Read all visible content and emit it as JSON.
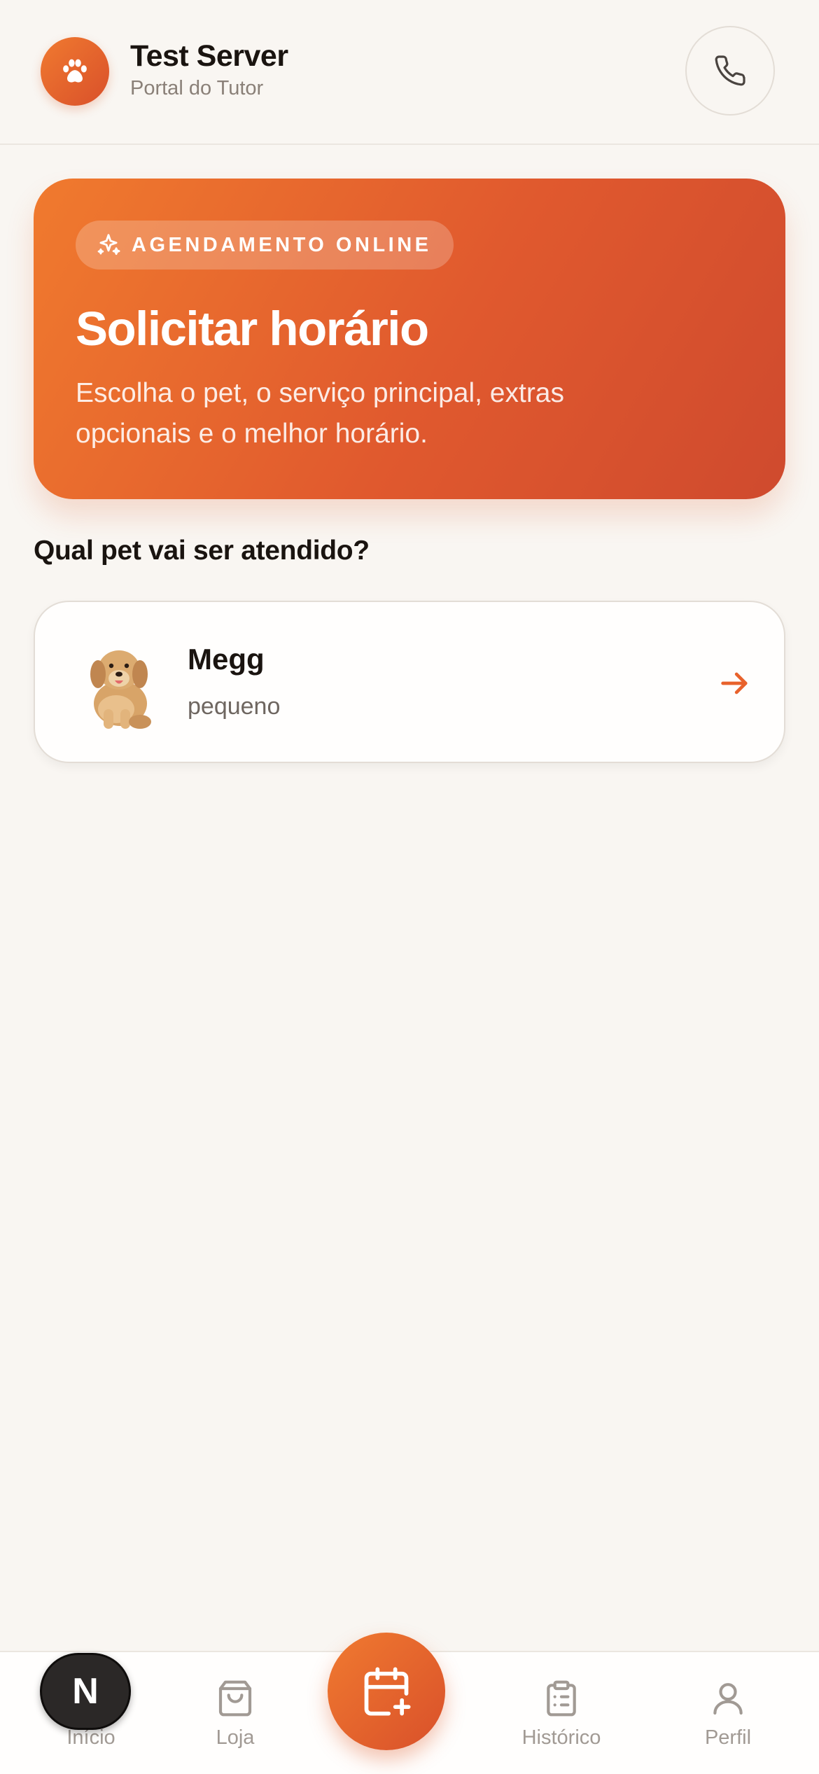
{
  "header": {
    "app_title": "Test Server",
    "subtitle": "Portal do Tutor",
    "logo_icon": "paw-icon",
    "action_icon": "phone-icon"
  },
  "hero": {
    "badge": "AGENDAMENTO ONLINE",
    "badge_icon": "sparkles-icon",
    "title": "Solicitar horário",
    "description": "Escolha o pet, o serviço principal, extras opcionais e o melhor horário."
  },
  "section": {
    "title": "Qual pet vai ser atendido?"
  },
  "pets": [
    {
      "name": "Megg",
      "size": "pequeno",
      "photo": "golden-retriever-puppy",
      "action_icon": "arrow-right-icon"
    }
  ],
  "bottom_nav": {
    "items": [
      {
        "label": "Início",
        "icon": "home-icon"
      },
      {
        "label": "Loja",
        "icon": "shopping-bag-icon"
      },
      {
        "label": "Histórico",
        "icon": "clipboard-list-icon"
      },
      {
        "label": "Perfil",
        "icon": "user-icon"
      }
    ],
    "fab_icon": "calendar-plus-icon",
    "overlay_badge": "N"
  },
  "colors": {
    "accent": "#e8622c",
    "accent_dark": "#cf4a2e",
    "background": "#f9f6f2"
  }
}
